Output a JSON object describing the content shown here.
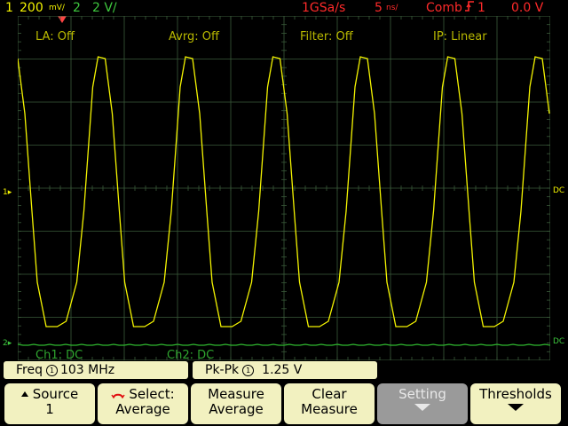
{
  "status_bar": {
    "ch1_number": "1",
    "ch1_scale": "200",
    "ch1_units": "mV/",
    "ch2_number": "2",
    "ch2_scale": "2 V/",
    "sample_rate": "1GSa/s",
    "timebase": "5",
    "timebase_units": "ns/",
    "acq_mode": "Comb",
    "trigger_source": "1",
    "trigger_level": "0.0 V"
  },
  "overlays": {
    "la": "LA: Off",
    "averaging": "Avrg: Off",
    "filter": "Filter: Off",
    "interpolation": "IP: Linear",
    "ch1_coupling": "Ch1: DC",
    "ch2_coupling": "Ch2: DC"
  },
  "markers": {
    "ch1_ground": "1",
    "ch2_ground": "2",
    "ch1_right": "DC",
    "ch2_right": "DC"
  },
  "measurements": {
    "freq_label": "Freq",
    "freq_source": "1",
    "freq_value": "103 MHz",
    "pkpk_label": "Pk-Pk",
    "pkpk_source": "1",
    "pkpk_value": "1.25  V"
  },
  "softkeys": {
    "source_top": "Source",
    "source_bottom": "1",
    "select_top": "Select:",
    "select_bottom": "Average",
    "measure_top": "Measure",
    "measure_bottom": "Average",
    "clear_top": "Clear",
    "clear_bottom": "Measure",
    "setting_top": "Setting",
    "thresholds_top": "Thresholds"
  },
  "colors": {
    "ch1": "#f4f400",
    "ch2": "#3ec83e",
    "grid": "#3a5a3a",
    "softkey": "#f2f1c0",
    "softkey_disabled": "#9a9a9a",
    "status_red": "#ff2a2a"
  },
  "waveforms": {
    "ch1_trace": {
      "kind": "repeating pulse",
      "cycles_visible": 6
    },
    "ch2_trace": {
      "kind": "flat",
      "level": "near bottom of graticule"
    }
  }
}
